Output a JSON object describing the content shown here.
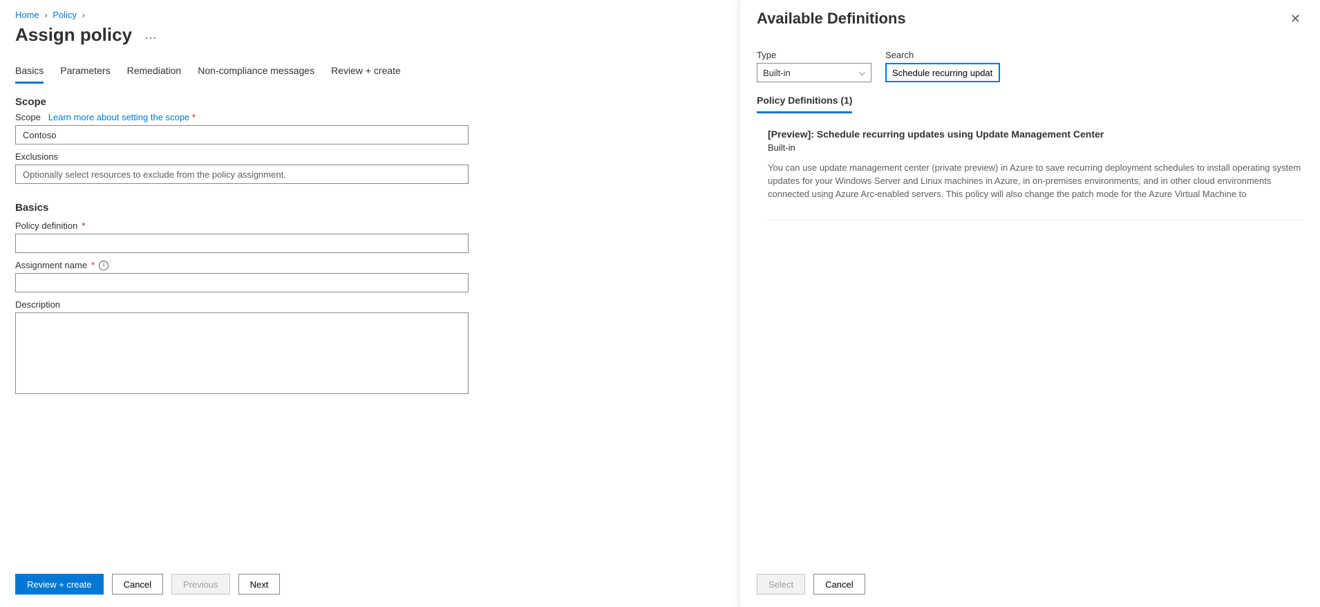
{
  "breadcrumb": {
    "home": "Home",
    "policy": "Policy"
  },
  "page": {
    "title": "Assign policy"
  },
  "tabs": {
    "basics": "Basics",
    "parameters": "Parameters",
    "remediation": "Remediation",
    "noncompliance": "Non-compliance messages",
    "review": "Review + create"
  },
  "scope": {
    "heading": "Scope",
    "label": "Scope",
    "learn_more": "Learn more about setting the scope",
    "value": "Contoso",
    "exclusions_label": "Exclusions",
    "exclusions_placeholder": "Optionally select resources to exclude from the policy assignment."
  },
  "basics": {
    "heading": "Basics",
    "policy_def_label": "Policy definition",
    "assignment_name_label": "Assignment name",
    "description_label": "Description"
  },
  "footer": {
    "review": "Review + create",
    "cancel": "Cancel",
    "previous": "Previous",
    "next": "Next"
  },
  "flyout": {
    "title": "Available Definitions",
    "type_label": "Type",
    "type_value": "Built-in",
    "search_label": "Search",
    "search_value": "Schedule recurring updat",
    "definitions_tab": "Policy Definitions (1)",
    "result": {
      "title": "[Preview]: Schedule recurring updates using Update Management Center",
      "type": "Built-in",
      "desc": "You can use update management center (private preview) in Azure to save recurring deployment schedules to install operating system updates for your Windows Server and Linux machines in Azure, in on-premises environments, and in other cloud environments connected using Azure Arc-enabled servers. This policy will also change the patch mode for the Azure Virtual Machine to"
    },
    "select": "Select",
    "cancel": "Cancel"
  }
}
